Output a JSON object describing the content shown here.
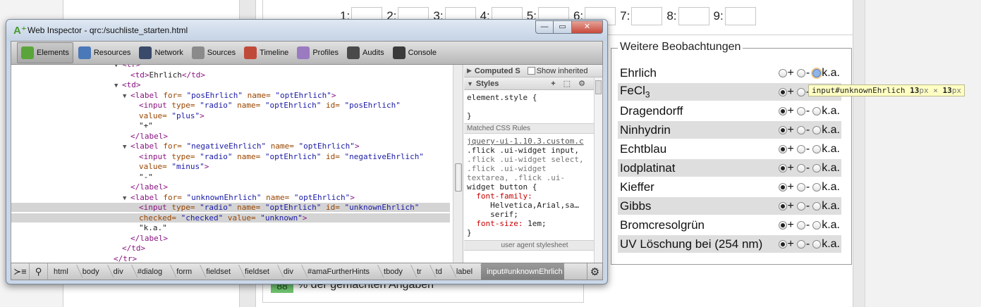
{
  "page": {
    "number_fields": [
      {
        "label": "1:"
      },
      {
        "label": "2:"
      },
      {
        "label": "3:"
      },
      {
        "label": "4:"
      },
      {
        "label": "5:"
      },
      {
        "label": "6:"
      },
      {
        "label": "7:"
      },
      {
        "label": "8:"
      },
      {
        "label": "9:"
      }
    ],
    "legend": "Weitere Beobachtungen",
    "opt_plus": "+",
    "opt_minus": "-",
    "opt_unknown": "k.a.",
    "observations": [
      {
        "name": "Ehrlich",
        "selected": "unknown"
      },
      {
        "name": "FeCl",
        "sub": "3",
        "selected": "plus"
      },
      {
        "name": "Dragendorff",
        "selected": "plus"
      },
      {
        "name": "Ninhydrin",
        "selected": "plus"
      },
      {
        "name": "Echtblau",
        "selected": "plus"
      },
      {
        "name": "Iodplatinat",
        "selected": "plus"
      },
      {
        "name": "Kieffer",
        "selected": "plus"
      },
      {
        "name": "Gibbs",
        "selected": "plus"
      },
      {
        "name": "Bromcresolgrün",
        "selected": "plus"
      },
      {
        "name": "UV Löschung bei (254 nm)",
        "selected": "plus"
      }
    ],
    "tooltip": {
      "selector": "input#unknownEhrlich",
      "w": "13",
      "h": "13",
      "unit": "px",
      "times": "×"
    },
    "bottom_pct": "88",
    "bottom_text": "% der gemachten Angaben"
  },
  "inspector": {
    "title": "Web Inspector - qrc:/suchliste_starten.html",
    "win_buttons": {
      "min": "—",
      "max": "▭",
      "close": "✕"
    },
    "tabs": [
      {
        "label": "Elements",
        "color": "#5aa53a"
      },
      {
        "label": "Resources",
        "color": "#4a78b8"
      },
      {
        "label": "Network",
        "color": "#3a4a6a"
      },
      {
        "label": "Sources",
        "color": "#8a8a8a"
      },
      {
        "label": "Timeline",
        "color": "#c04a3a"
      },
      {
        "label": "Profiles",
        "color": "#9a7ac0"
      },
      {
        "label": "Audits",
        "color": "#4a4a4a"
      },
      {
        "label": "Console",
        "color": "#3a3a3a"
      }
    ],
    "dom_lines": [
      {
        "indent": 0,
        "tw": "▼",
        "html": "<span class='tag'>&lt;tr&gt;</span>"
      },
      {
        "indent": 1,
        "tw": "",
        "html": "<span class='tag'>&lt;td&gt;</span>Ehrlich<span class='tag'>&lt;/td&gt;</span>"
      },
      {
        "indent": 0,
        "tw": "▼",
        "html": "<span class='tag'>&lt;td&gt;</span>"
      },
      {
        "indent": 1,
        "tw": "▼",
        "html": "<span class='tag'>&lt;label </span><span class='an'>for=</span> <span class='av'>\"posEhrlich\"</span> <span class='an'>name=</span> <span class='av'>\"optEhrlich\"</span><span class='tag'>&gt;</span>"
      },
      {
        "indent": 2,
        "tw": "",
        "html": "<span class='tag'>&lt;input </span><span class='an'>type=</span> <span class='av'>\"radio\"</span> <span class='an'>name=</span> <span class='av'>\"optEhrlich\"</span> <span class='an'>id=</span> <span class='av'>\"posEhrlich\"</span>"
      },
      {
        "indent": 2,
        "tw": "",
        "html": "<span class='an'>value=</span> <span class='av'>\"plus\"</span><span class='tag'>&gt;</span>"
      },
      {
        "indent": 2,
        "tw": "",
        "html": "\"+\""
      },
      {
        "indent": 1,
        "tw": "",
        "html": "<span class='tag'>&lt;/label&gt;</span>"
      },
      {
        "indent": 1,
        "tw": "▼",
        "html": "<span class='tag'>&lt;label </span><span class='an'>for=</span> <span class='av'>\"negativeEhrlich\"</span> <span class='an'>name=</span> <span class='av'>\"optEhrlich\"</span><span class='tag'>&gt;</span>"
      },
      {
        "indent": 2,
        "tw": "",
        "html": "<span class='tag'>&lt;input </span><span class='an'>type=</span> <span class='av'>\"radio\"</span> <span class='an'>name=</span> <span class='av'>\"optEhrlich\"</span> <span class='an'>id=</span> <span class='av'>\"negativeEhrlich\"</span>"
      },
      {
        "indent": 2,
        "tw": "",
        "html": "<span class='an'>value=</span> <span class='av'>\"minus\"</span><span class='tag'>&gt;</span>"
      },
      {
        "indent": 2,
        "tw": "",
        "html": "\"-\""
      },
      {
        "indent": 1,
        "tw": "",
        "html": "<span class='tag'>&lt;/label&gt;</span>"
      },
      {
        "indent": 1,
        "tw": "▼",
        "html": "<span class='tag'>&lt;label </span><span class='an'>for=</span> <span class='av'>\"unknownEhrlich\"</span> <span class='an'>name=</span> <span class='av'>\"optEhrlich\"</span><span class='tag'>&gt;</span>"
      },
      {
        "indent": 2,
        "tw": "",
        "sel": true,
        "html": "<span class='tag'>&lt;input </span><span class='an'>type=</span> <span class='av'>\"radio\"</span> <span class='an'>name=</span> <span class='av'>\"optEhrlich\"</span> <span class='an'>id=</span> <span class='av'>\"unknownEhrlich\"</span>"
      },
      {
        "indent": 2,
        "tw": "",
        "sel": true,
        "html": "<span class='an'>checked=</span> <span class='av'>\"checked\"</span> <span class='an'>value=</span> <span class='av'>\"unknown\"</span><span class='tag'>&gt;</span>"
      },
      {
        "indent": 2,
        "tw": "",
        "html": "\"k.a.\""
      },
      {
        "indent": 1,
        "tw": "",
        "html": "<span class='tag'>&lt;/label&gt;</span>"
      },
      {
        "indent": 0,
        "tw": "",
        "html": "<span class='tag'>&lt;/td&gt;</span>"
      },
      {
        "indent": -1,
        "tw": "",
        "html": "<span class='tag'>&lt;/tr&gt;</span>"
      }
    ],
    "computed_label": "Computed S",
    "show_inherited": "Show inherited",
    "styles_label": "Styles",
    "styles_icons": "+ ⬚ ⚙",
    "element_style": "element.style {",
    "close_brace": "}",
    "matched_rules": "Matched CSS Rules",
    "source": "jquery-ui-1.10.3.custom.c",
    "selector_lines": [
      ".flick .ui-widget input,",
      ".flick .ui-widget select,",
      ".flick .ui-widget",
      "textarea, .flick .ui-",
      "widget button {"
    ],
    "font_family_prop": "font-family:",
    "font_family_val1": "Helvetica,Arial,sa…",
    "font_family_val2": "serif;",
    "font_size_prop": "font-size:",
    "font_size_val": "1em;",
    "user_agent": "user agent stylesheet",
    "console_icon": "≻≡",
    "search_icon": "⚲",
    "breadcrumbs": [
      "html",
      "body",
      "div",
      "#dialog",
      "form",
      "fieldset",
      "fieldset",
      "div",
      "#amaFurtherHints",
      "tbody",
      "tr",
      "td",
      "label"
    ],
    "current_crumb": "input#unknownEhrlich",
    "gear_icon": "⚙"
  }
}
